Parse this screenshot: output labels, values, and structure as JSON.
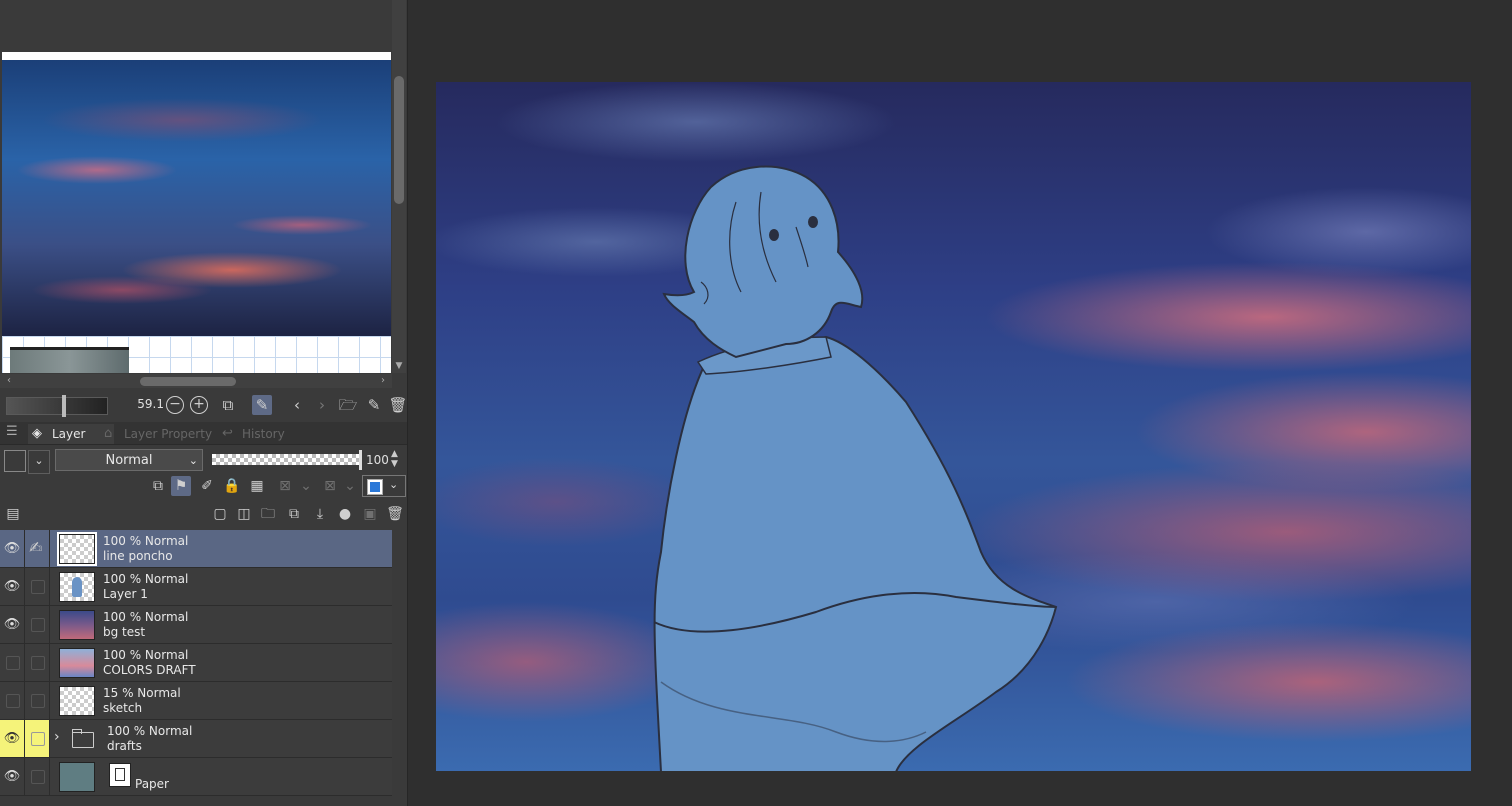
{
  "navigator": {
    "zoom_value": "59.1",
    "zoom_out_icon": "zoom-out-icon",
    "zoom_in_icon": "zoom-in-icon"
  },
  "tabs": {
    "layer": "Layer",
    "layer_property": "Layer Property",
    "history": "History"
  },
  "layer_panel": {
    "blend_mode": "Normal",
    "opacity": "100",
    "selected_color": "#2a78d8"
  },
  "layers": [
    {
      "opacity_mode": "100 % Normal",
      "name": "line poncho",
      "visible": true,
      "selected": true
    },
    {
      "opacity_mode": "100 % Normal",
      "name": "Layer 1",
      "visible": true,
      "selected": false
    },
    {
      "opacity_mode": "100 % Normal",
      "name": "bg test",
      "visible": true,
      "selected": false
    },
    {
      "opacity_mode": "100 % Normal",
      "name": "COLORS DRAFT",
      "visible": false,
      "selected": false
    },
    {
      "opacity_mode": "15 % Normal",
      "name": "sketch",
      "visible": false,
      "selected": false
    },
    {
      "opacity_mode": "100 % Normal",
      "name": "drafts",
      "visible": true,
      "selected": false,
      "folder": true
    },
    {
      "opacity_mode": "",
      "name": "Paper",
      "visible": true,
      "selected": false
    }
  ],
  "colors": {
    "selection": "#5a6784",
    "highlight": "#f5f37a",
    "figure": "#6a93c5"
  }
}
